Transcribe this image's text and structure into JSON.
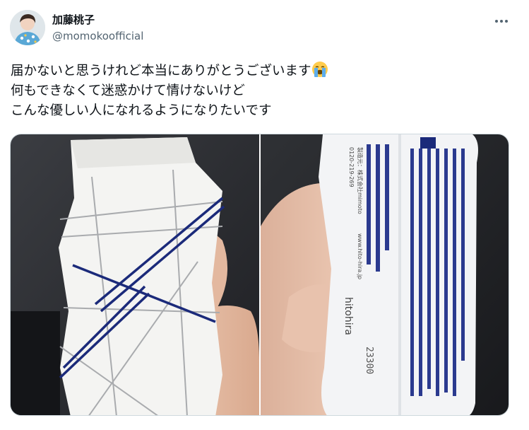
{
  "user": {
    "display_name": "加藤桃子",
    "handle": "@momokoofficial"
  },
  "tweet": {
    "line1": "届かないと思うけれど本当にありがとうございます",
    "line1_emoji": "loudly-crying-face",
    "line2": "何もできなくて迷惑かけて情けないけど",
    "line3": "こんな優しい人になれるようになりたいです"
  },
  "media": {
    "left_photo": {
      "icon": "wet-towel-package-front"
    },
    "right_photo": {
      "icon": "wet-towel-package-back",
      "brand": "hitohira",
      "maker": "製造元：株式会社mimoto",
      "url": "www.hito-hira.jp",
      "tel": "0120-219-269",
      "number": "23300"
    }
  },
  "colors": {
    "text": "#0f1419",
    "secondary": "#536471",
    "border": "#cfd9de",
    "package_stripe": "#1b2a7a"
  }
}
